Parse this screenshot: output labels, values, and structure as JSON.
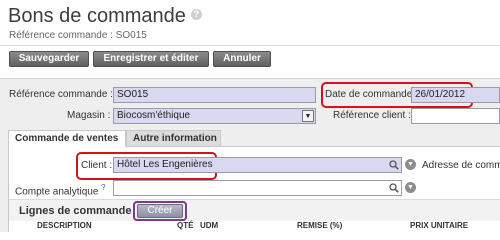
{
  "header": {
    "title": "Bons de commande",
    "help": "?",
    "subtitle": "Référence commande : SO015"
  },
  "toolbar": {
    "save": "Sauvegarder",
    "save_edit": "Enregistrer et éditer",
    "cancel": "Annuler"
  },
  "form": {
    "ref_label": "Référence commande :",
    "ref_value": "SO015",
    "date_label": "Date de commande :",
    "date_value": "26/01/2012",
    "store_label": "Magasin :",
    "store_value": "Biocosm'éthique",
    "client_ref_label": "Référence client :",
    "client_ref_value": ""
  },
  "tabs": [
    {
      "label": "Commande de ventes",
      "active": true
    },
    {
      "label": "Autre information",
      "active": false
    }
  ],
  "sales": {
    "client_label": "Client :",
    "client_value": "Hôtel Les Engenières",
    "delivery_label": "Adresse de comma",
    "analytic_label": "Compte analytique",
    "analytic_help": "?",
    "analytic_value": ""
  },
  "lines": {
    "title": "Lignes de commande",
    "create": "Créer",
    "columns": [
      "DESCRIPTION",
      "QTÉ",
      "UDM",
      "REMISE (%)",
      "PRIX UNITAIRE"
    ]
  },
  "colors": {
    "required_field": "#d8d8f0",
    "highlight": "#d0141e",
    "create_highlight": "#7b3b86"
  }
}
